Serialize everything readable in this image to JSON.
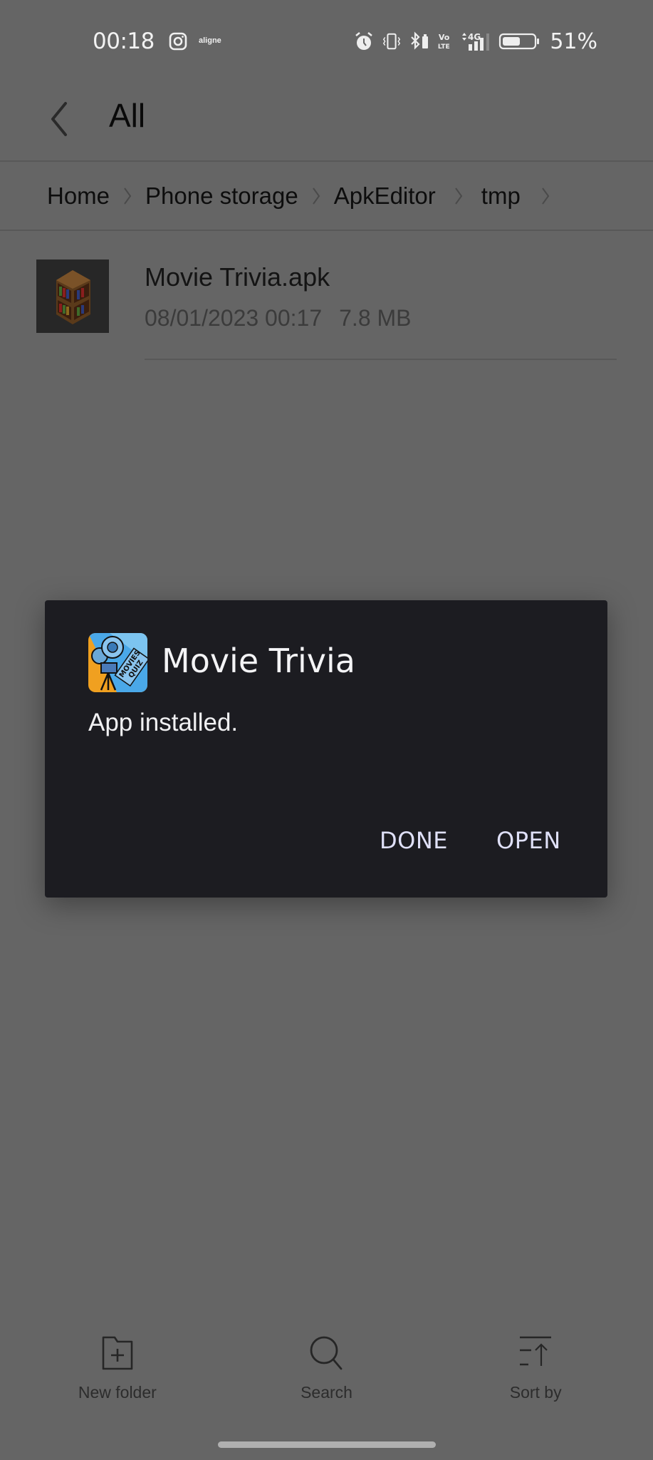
{
  "status_bar": {
    "time": "00:18",
    "notification_icons": [
      "instagram-icon"
    ],
    "notification_text": "aligne",
    "system_icons": [
      "alarm-icon",
      "vibrate-icon",
      "bluetooth-battery-icon",
      "volte-icon",
      "4g-signal-icon",
      "battery-icon"
    ],
    "battery_percent": "51%",
    "battery_level": 0.51
  },
  "app_bar": {
    "back_icon": "chevron-left-icon",
    "title": "All"
  },
  "breadcrumb": {
    "items": [
      "Home",
      "Phone storage",
      "ApkEditor",
      "tmp"
    ],
    "separator_icon": "chevron-right-icon"
  },
  "files": [
    {
      "name": "Movie Trivia.apk",
      "date": "08/01/2023 00:17",
      "size": "7.8 MB",
      "icon": "bookshelf-apk-icon"
    }
  ],
  "dialog": {
    "app_name": "Movie Trivia",
    "app_icon": "movies-quiz-app-icon",
    "app_icon_text": "MOVIES QUIZ",
    "message": "App installed.",
    "buttons": {
      "done": "DONE",
      "open": "OPEN"
    },
    "button_color": "#dfe0f8"
  },
  "bottom_bar": {
    "items": [
      {
        "label": "New folder",
        "icon": "new-folder-icon"
      },
      {
        "label": "Search",
        "icon": "search-icon"
      },
      {
        "label": "Sort by",
        "icon": "sort-icon"
      }
    ]
  },
  "colors": {
    "scrim_background": "#656565",
    "dialog_background": "#1c1c21"
  }
}
